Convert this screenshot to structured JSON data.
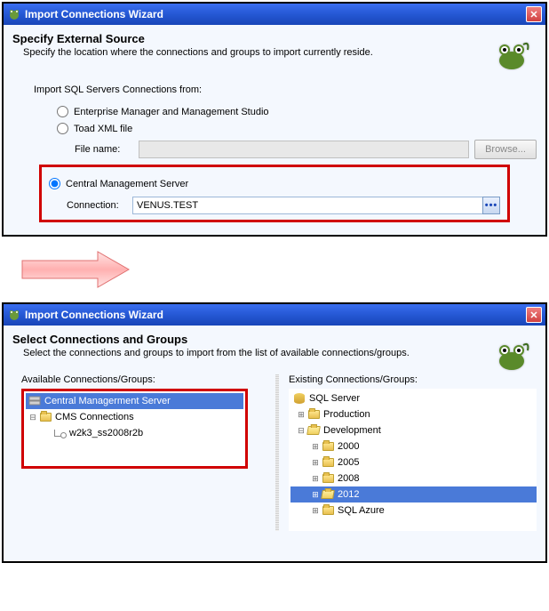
{
  "window1": {
    "title": "Import Connections Wizard",
    "header": "Specify External Source",
    "subheader": "Specify the location where the connections and groups to import currently reside.",
    "section_label": "Import SQL Servers Connections from:",
    "radio_ems": "Enterprise Manager and Management Studio",
    "radio_xml": "Toad XML file",
    "file_label": "File name:",
    "browse": "Browse...",
    "radio_cms": "Central Management Server",
    "conn_label": "Connection:",
    "conn_value": "VENUS.TEST"
  },
  "window2": {
    "title": "Import Connections Wizard",
    "header": "Select Connections and Groups",
    "subheader": "Select the connections and groups to import from the list of available connections/groups.",
    "left_title": "Available Connections/Groups:",
    "right_title": "Existing Connections/Groups:",
    "left_tree": {
      "root": "Central Managerment Server",
      "group": "CMS Connections",
      "item": "w2k3_ss2008r2b"
    },
    "right_tree": {
      "root": "SQL Server",
      "production": "Production",
      "development": "Development",
      "y_2000": "2000",
      "y_2005": "2005",
      "y_2008": "2008",
      "y_2012": "2012",
      "azure": "SQL Azure"
    }
  }
}
